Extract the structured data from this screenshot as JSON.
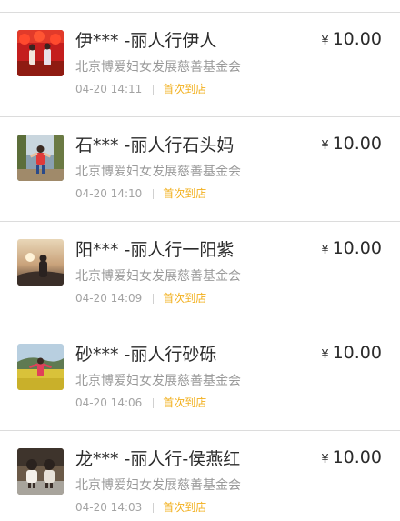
{
  "donations": [
    {
      "name": "伊*** -丽人行伊人",
      "org": "北京博爱妇女发展慈善基金会",
      "time": "04-20 14:11",
      "tag": "首次到店",
      "currency": "¥",
      "amount": "10.00",
      "avatar_icon": "photo-red-lanterns-icon"
    },
    {
      "name": "石*** -丽人行石头妈",
      "org": "北京博爱妇女发展慈善基金会",
      "time": "04-20 14:10",
      "tag": "首次到店",
      "currency": "¥",
      "amount": "10.00",
      "avatar_icon": "photo-child-outdoor-icon"
    },
    {
      "name": "阳*** -丽人行一阳紫",
      "org": "北京博爱妇女发展慈善基金会",
      "time": "04-20 14:09",
      "tag": "首次到店",
      "currency": "¥",
      "amount": "10.00",
      "avatar_icon": "photo-sunset-person-icon"
    },
    {
      "name": "砂*** -丽人行砂砾",
      "org": "北京博爱妇女发展慈善基金会",
      "time": "04-20 14:06",
      "tag": "首次到店",
      "currency": "¥",
      "amount": "10.00",
      "avatar_icon": "photo-flower-field-icon"
    },
    {
      "name": "龙*** -丽人行-侯燕红",
      "org": "北京博爱妇女发展慈善基金会",
      "time": "04-20 14:03",
      "tag": "首次到店",
      "currency": "¥",
      "amount": "10.00",
      "avatar_icon": "photo-two-children-icon"
    }
  ],
  "colors": {
    "tag": "#f2b01e",
    "name": "#2b2b2b",
    "secondary": "#9a9a9a",
    "divider": "#dcdcdc"
  }
}
